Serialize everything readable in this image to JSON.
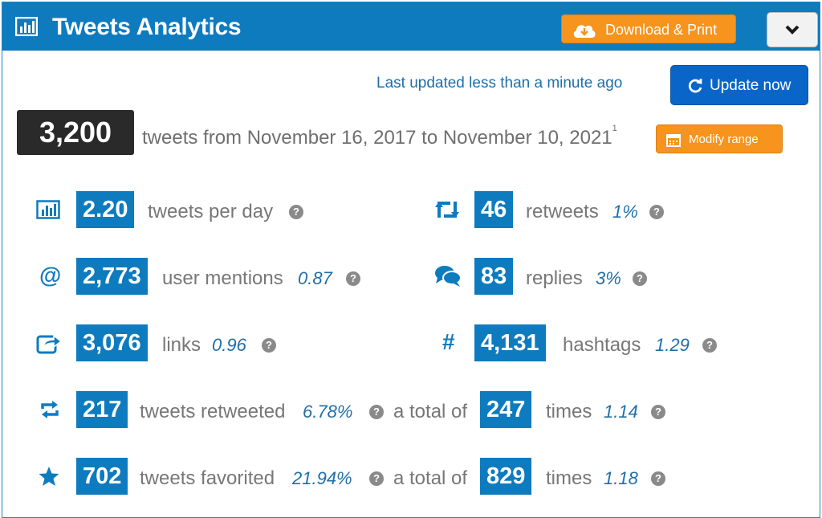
{
  "header": {
    "title": "Tweets Analytics",
    "download_label": "Download & Print"
  },
  "status": {
    "last_updated": "Last updated less than a minute ago",
    "update_label": "Update now"
  },
  "summary": {
    "total": "3,200",
    "range": "tweets from November 16, 2017 to November 10, 2021",
    "footnote": "1",
    "modify_label": "Modify range"
  },
  "stats": {
    "tweets_per_day": {
      "value": "2.20",
      "label": "tweets per day",
      "help": "?"
    },
    "retweets": {
      "value": "46",
      "label": "retweets",
      "pct": "1%",
      "help": "?"
    },
    "mentions": {
      "value": "2,773",
      "label": "user mentions",
      "pct": "0.87",
      "help": "?"
    },
    "replies": {
      "value": "83",
      "label": "replies",
      "pct": "3%",
      "help": "?"
    },
    "links": {
      "value": "3,076",
      "label": "links",
      "pct": "0.96",
      "help": "?"
    },
    "hashtags": {
      "value": "4,131",
      "label": "hashtags",
      "pct": "1.29",
      "help": "?"
    },
    "retweeted": {
      "value": "217",
      "label": "tweets retweeted",
      "pct": "6.78%",
      "help": "?",
      "total_label": "a total of",
      "total": "247",
      "times_label": "times",
      "times_pct": "1.14",
      "help2": "?"
    },
    "favorited": {
      "value": "702",
      "label": "tweets favorited",
      "pct": "21.94%",
      "help": "?",
      "total_label": "a total of",
      "total": "829",
      "times_label": "times",
      "times_pct": "1.18",
      "help2": "?"
    }
  },
  "icons": {
    "mention_glyph": "@",
    "hashtag_glyph": "#"
  },
  "colors": {
    "brand_blue": "#0e7bbf",
    "orange": "#f7941d",
    "update_blue": "#0966c8",
    "dark_box": "#2a2a2a"
  }
}
